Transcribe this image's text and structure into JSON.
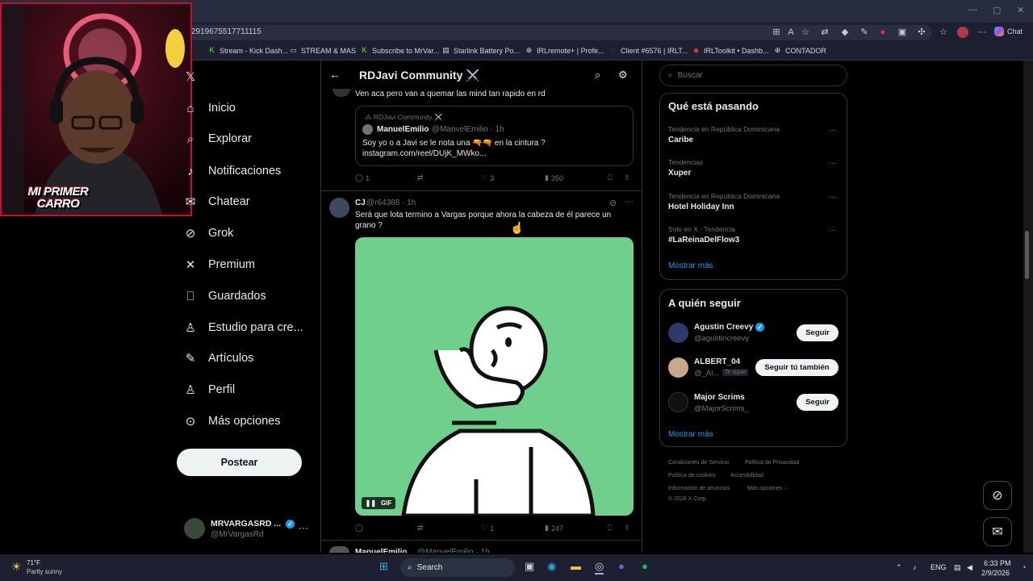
{
  "browser": {
    "url": "2919675517711115",
    "chat_label": "Chat",
    "bookmarks": [
      "Stream - Kick Dash...",
      "STREAM & MAS",
      "Subscribe to MrVar...",
      "Starlink Battery Po...",
      "IRLremote+ | Profe...",
      "Client #6576 | IRLT...",
      "IRLToolkit • Dashb...",
      "CONTADOR"
    ]
  },
  "webcam": {
    "overlay_text_line1": "MI PRIMER",
    "overlay_text_line2": "CARRO"
  },
  "nav": {
    "items": [
      "Inicio",
      "Explorar",
      "Notificaciones",
      "Chatear",
      "Grok",
      "Premium",
      "Guardados",
      "Estudio para cre...",
      "Artículos",
      "Perfil",
      "Más opciones"
    ],
    "post_label": "Postear",
    "account": {
      "name": "MRVARGASRD ...",
      "handle": "@MrVargasRd"
    }
  },
  "community": {
    "title": "RDJavi Community ⚔️",
    "reply_text": "Ven aca pero van a quemar las mind tan rapido en rd",
    "quote": {
      "community": "RDJavi Community ⚔️",
      "author": "ManuelEmilio",
      "handle_time": "@ManvelEmilio · 1h",
      "text_line1": "Soy yo o a Javi se le nota una 🔫🔫 en la cintura ?",
      "text_line2": "instagram.com/reel/DUjK_MWko..."
    },
    "post1_actions": {
      "replies": "1",
      "reposts": "",
      "likes": "3",
      "views": "350"
    },
    "post2": {
      "author": "CJ",
      "handle_time": "@r64388 · 1h",
      "text_line1": "Será que lota termino a Vargas porque ahora la cabeza de él parece un",
      "text_line2": "grano ?",
      "gif_label": "GIF",
      "actions": {
        "replies": "",
        "reposts": "",
        "likes": "1",
        "views": "247"
      }
    },
    "post3_preview": {
      "author": "ManuelEmilio",
      "handle_time": "@ManvelEmilio · 1h"
    }
  },
  "right": {
    "search_placeholder": "Buscar",
    "trends_title": "Qué está pasando",
    "trends": [
      {
        "context": "Tendencia en República Dominicana",
        "name": "Caribe"
      },
      {
        "context": "Tendencias",
        "name": "Xuper"
      },
      {
        "context": "Tendencia en República Dominicana",
        "name": "Hotel Holiday Inn"
      },
      {
        "context": "Solo en X · Tendencia",
        "name": "#LaReinaDelFlow3"
      }
    ],
    "show_more": "Mostrar más",
    "follow_title": "A quién seguir",
    "follow": [
      {
        "name": "Agustin Creevy",
        "handle": "@agustincreevy",
        "button": "Seguir"
      },
      {
        "name": "ALBERT_04",
        "handle": "@_Al...",
        "badge": "Te sigue",
        "button": "Seguir tú también"
      },
      {
        "name": "Major Scrims",
        "handle": "@MajorScrims_",
        "button": "Seguir"
      }
    ],
    "footer": {
      "l1a": "Condiciones de Servicio",
      "l1b": "Política de Privacidad",
      "l2a": "Política de cookies",
      "l2b": "Accesibilidad",
      "l3a": "Información de anuncios",
      "l3b": "Más opciones ···",
      "copyright": "© 2026 X Corp."
    }
  },
  "taskbar": {
    "weather_temp": "71°F",
    "weather_desc": "Partly sunny",
    "search_label": "Search",
    "lang": "ENG",
    "time": "6:33 PM",
    "date": "2/9/2026"
  },
  "colors": {
    "accent": "#1d9bf0",
    "gif_bg": "#71cf8e",
    "cam_border": "#c8102e"
  }
}
